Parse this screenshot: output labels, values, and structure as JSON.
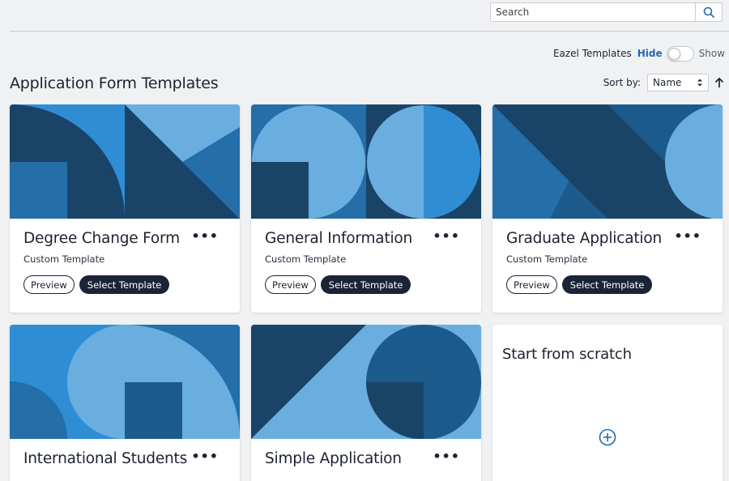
{
  "search": {
    "placeholder": "Search",
    "value": "",
    "icon": "search-icon"
  },
  "eazel": {
    "label": "Eazel Templates",
    "hide_label": "Hide",
    "show_label": "Show",
    "toggle_on": false
  },
  "page": {
    "title": "Application Form Templates"
  },
  "sort": {
    "label": "Sort by:",
    "selected": "Name",
    "direction_icon": "arrow-up-icon"
  },
  "colors": {
    "dark": "#194468",
    "mid": "#246ea9",
    "bright": "#2f8dd4",
    "light": "#6aaee0",
    "button_dark": "#1b2436",
    "link": "#1f6bb0"
  },
  "templates": [
    {
      "title": "Degree Change Form",
      "subtitle": "Custom Template",
      "preview_label": "Preview",
      "select_label": "Select Template",
      "more_icon": "more-horizontal-icon"
    },
    {
      "title": "General Information",
      "subtitle": "Custom Template",
      "preview_label": "Preview",
      "select_label": "Select Template",
      "more_icon": "more-horizontal-icon"
    },
    {
      "title": "Graduate Application",
      "subtitle": "Custom Template",
      "preview_label": "Preview",
      "select_label": "Select Template",
      "more_icon": "more-horizontal-icon"
    },
    {
      "title": "International Students",
      "more_icon": "more-horizontal-icon"
    },
    {
      "title": "Simple Application",
      "more_icon": "more-horizontal-icon"
    }
  ],
  "scratch": {
    "title": "Start from scratch",
    "icon": "plus-circle-icon"
  }
}
